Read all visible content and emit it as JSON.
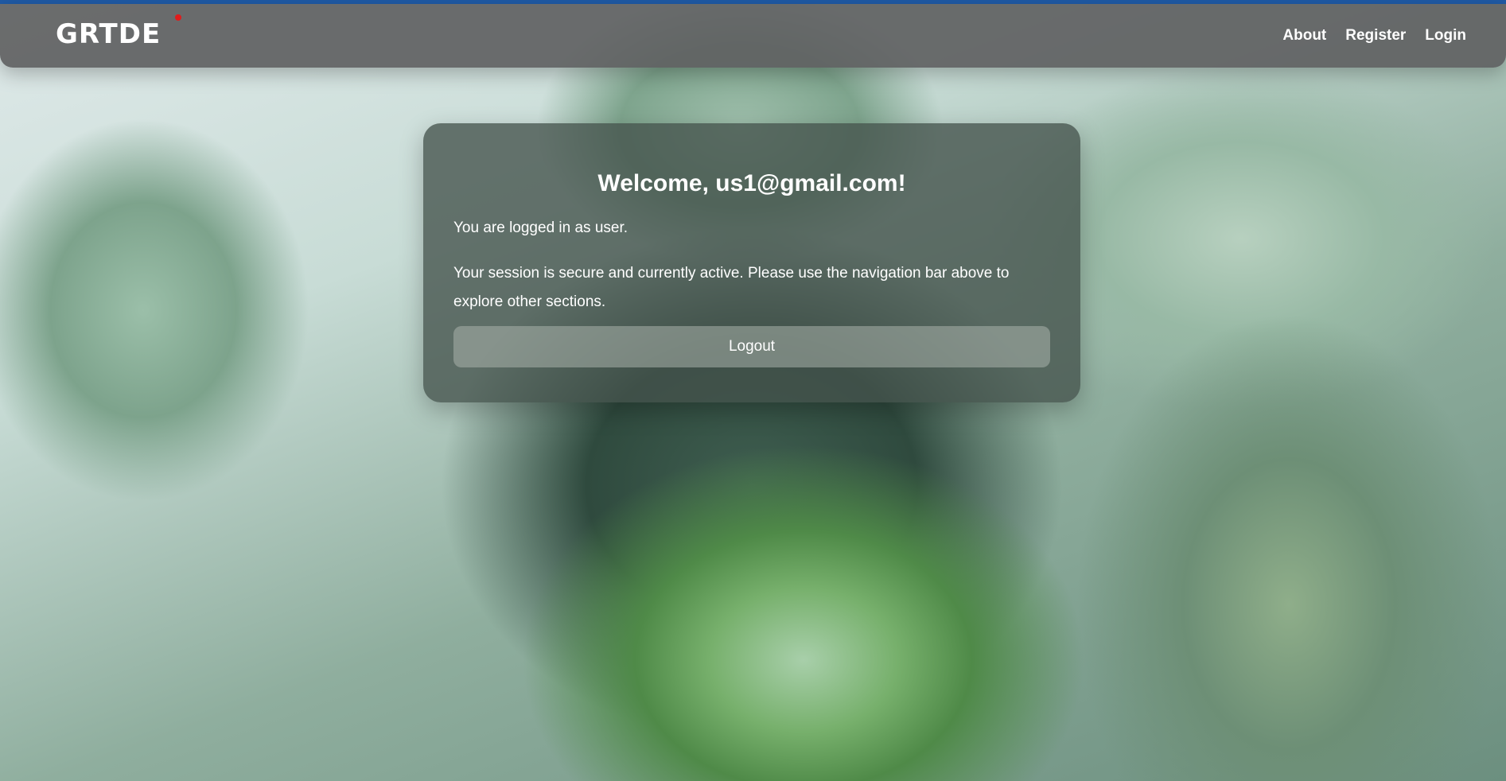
{
  "brand": {
    "logo_text": "GRTDE",
    "accent_color": "#e11b1b"
  },
  "nav": {
    "links": [
      {
        "label": "About"
      },
      {
        "label": "Register"
      },
      {
        "label": "Login"
      }
    ]
  },
  "card": {
    "welcome": "Welcome, us1@gmail.com!",
    "role_text": "You are logged in as user.",
    "session_text": "Your session is secure and currently active. Please use the navigation bar above to explore other sections.",
    "logout_label": "Logout"
  }
}
